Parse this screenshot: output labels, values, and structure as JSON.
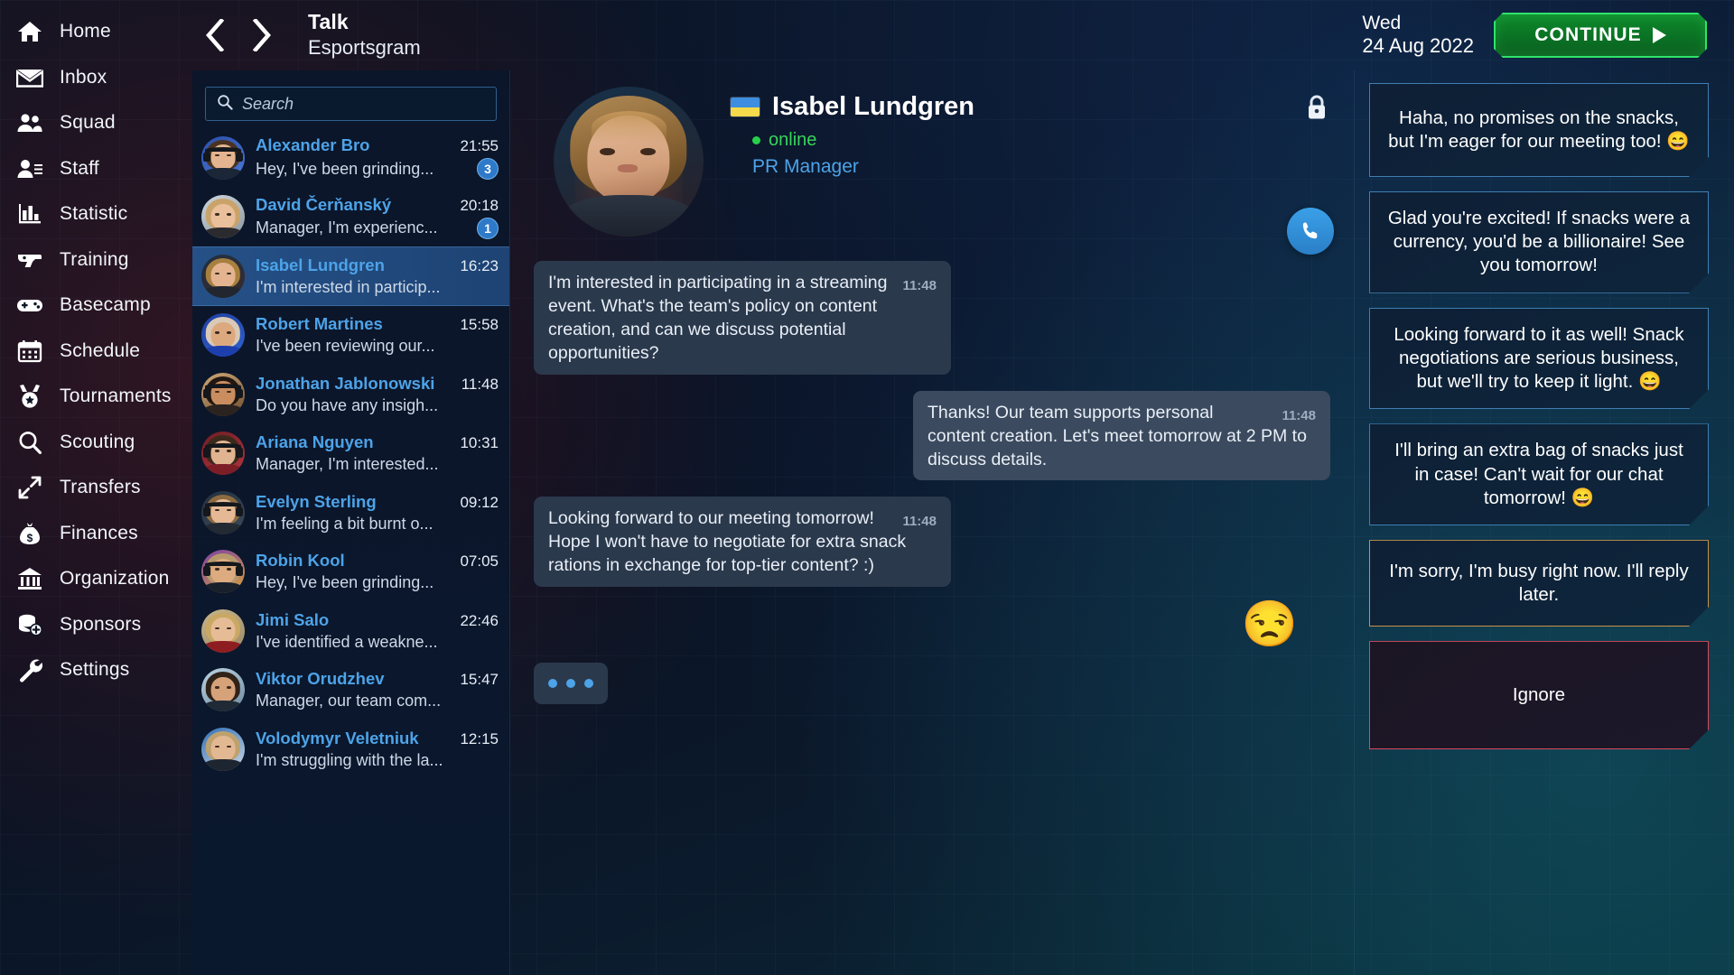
{
  "header": {
    "back_icon": "chevron-left-icon",
    "forward_icon": "chevron-right-icon",
    "title": "Talk",
    "subtitle": "Esportsgram",
    "date_day": "Wed",
    "date_full": "24 Aug 2022",
    "continue_label": "CONTINUE"
  },
  "sidebar": {
    "items": [
      {
        "label": "Home",
        "icon": "home-icon"
      },
      {
        "label": "Inbox",
        "icon": "envelope-icon"
      },
      {
        "label": "Squad",
        "icon": "users-icon"
      },
      {
        "label": "Staff",
        "icon": "person-list-icon"
      },
      {
        "label": "Statistic",
        "icon": "bar-chart-icon"
      },
      {
        "label": "Training",
        "icon": "pistol-icon"
      },
      {
        "label": "Basecamp",
        "icon": "gamepad-icon"
      },
      {
        "label": "Schedule",
        "icon": "calendar-icon"
      },
      {
        "label": "Tournaments",
        "icon": "medal-icon"
      },
      {
        "label": "Scouting",
        "icon": "magnifier-icon"
      },
      {
        "label": "Transfers",
        "icon": "arrows-diagonal-icon"
      },
      {
        "label": "Finances",
        "icon": "money-bag-icon"
      },
      {
        "label": "Organization",
        "icon": "bank-icon"
      },
      {
        "label": "Sponsors",
        "icon": "coins-plus-icon"
      },
      {
        "label": "Settings",
        "icon": "wrench-icon"
      }
    ]
  },
  "search": {
    "placeholder": "Search",
    "value": "",
    "icon": "search-icon"
  },
  "conversations": [
    {
      "name": "Alexander Bro",
      "time": "21:55",
      "preview": "Hey, I've been grinding...",
      "badge": "3",
      "selected": false
    },
    {
      "name": "David Čerňanský",
      "time": "20:18",
      "preview": "Manager, I'm experienc...",
      "badge": "1",
      "selected": false
    },
    {
      "name": "Isabel Lundgren",
      "time": "16:23",
      "preview": "I'm interested in particip...",
      "badge": "",
      "selected": true
    },
    {
      "name": "Robert Martines",
      "time": "15:58",
      "preview": "I've been reviewing our...",
      "badge": "",
      "selected": false
    },
    {
      "name": "Jonathan Jablonowski",
      "time": "11:48",
      "preview": "Do you have any insigh...",
      "badge": "",
      "selected": false
    },
    {
      "name": "Ariana Nguyen",
      "time": "10:31",
      "preview": "Manager, I'm interested...",
      "badge": "",
      "selected": false
    },
    {
      "name": "Evelyn Sterling",
      "time": "09:12",
      "preview": "I'm feeling a bit burnt o...",
      "badge": "",
      "selected": false
    },
    {
      "name": "Robin Kool",
      "time": "07:05",
      "preview": "Hey, I've been grinding...",
      "badge": "",
      "selected": false
    },
    {
      "name": "Jimi Salo",
      "time": "22:46",
      "preview": "I've identified a weakne...",
      "badge": "",
      "selected": false
    },
    {
      "name": "Viktor Orudzhev",
      "time": "15:47",
      "preview": "Manager, our team com...",
      "badge": "",
      "selected": false
    },
    {
      "name": "Volodymyr Veletniuk",
      "time": "12:15",
      "preview": "I'm struggling with the la...",
      "badge": "",
      "selected": false
    }
  ],
  "chat": {
    "contact_name": "Isabel Lundgren",
    "flag": "ukraine-flag-icon",
    "status": "online",
    "role": "PR Manager",
    "lock_icon": "lock-icon",
    "call_icon": "phone-icon",
    "avatar_label": "isabel-lundgren-portrait",
    "messages": [
      {
        "direction": "in",
        "text": "I'm interested in participating in a streaming event. What's the team's policy on content creation, and can we discuss potential opportunities?",
        "time": "11:48"
      },
      {
        "direction": "out",
        "text": "Thanks! Our team supports personal content creation. Let's meet tomorrow at 2 PM to discuss details.",
        "time": "11:48"
      },
      {
        "direction": "in",
        "text": "Looking forward to our meeting tomorrow! Hope I won't have to negotiate for extra snack rations in exchange for top-tier content? :)",
        "time": "11:48"
      }
    ],
    "reaction_emoji": "😒",
    "typing_indicator": "typing-dots"
  },
  "replies": [
    {
      "text": "Haha, no promises on the snacks, but I'm eager for our meeting too! 😄",
      "style": "normal"
    },
    {
      "text": "Glad you're excited! If snacks were a currency, you'd be a billionaire! See you tomorrow!",
      "style": "normal"
    },
    {
      "text": "Looking forward to it as well! Snack negotiations are serious business, but we'll try to keep it light. 😄",
      "style": "normal"
    },
    {
      "text": "I'll bring an extra bag of snacks just in case! Can't wait for our chat tomorrow! 😄",
      "style": "normal"
    },
    {
      "text": "I'm sorry, I'm busy right now. I'll reply later.",
      "style": "busy"
    },
    {
      "text": "Ignore",
      "style": "ignore"
    }
  ],
  "colors": {
    "accent_blue": "#4da3e8",
    "online_green": "#36d45b",
    "continue_green": "#2fe36a",
    "busy_border": "#c99249",
    "ignore_border": "#d9485c",
    "badge_blue": "#2f79c9"
  }
}
